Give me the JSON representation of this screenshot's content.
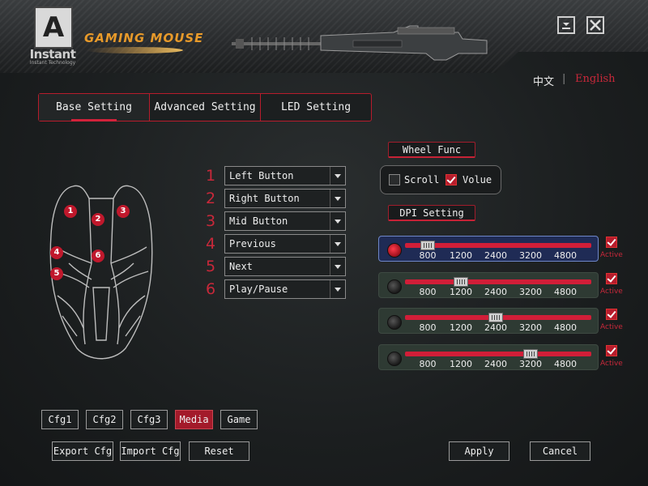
{
  "header": {
    "logo_letter": "A",
    "logo_word": "Instant",
    "logo_subtitle": "Instant Technology",
    "brand_title": "GAMING MOUSE",
    "minimize_icon": "minimize-icon",
    "close_icon": "close-icon"
  },
  "language": {
    "chinese": "中文",
    "separator": "|",
    "english": "English",
    "active_color": "#c8283a"
  },
  "tabs": [
    {
      "label": "Base Setting",
      "active": true
    },
    {
      "label": "Advanced Setting",
      "active": false
    },
    {
      "label": "LED Setting",
      "active": false
    }
  ],
  "buttons_config": [
    {
      "number": "1",
      "value": "Left Button"
    },
    {
      "number": "2",
      "value": "Right Button"
    },
    {
      "number": "3",
      "value": "Mid Button"
    },
    {
      "number": "4",
      "value": "Previous"
    },
    {
      "number": "5",
      "value": "Next"
    },
    {
      "number": "6",
      "value": "Play/Pause"
    }
  ],
  "mouse_badges": [
    "1",
    "2",
    "3",
    "4",
    "5",
    "6"
  ],
  "wheel": {
    "title": "Wheel Func",
    "scroll_label": "Scroll",
    "scroll_checked": false,
    "volume_label": "Volue",
    "volume_checked": true
  },
  "dpi": {
    "title": "DPI Setting",
    "ticks": [
      "800",
      "1200",
      "2400",
      "3200",
      "4800"
    ],
    "rows": [
      {
        "selected": true,
        "value": "800",
        "active": true,
        "active_label": "Active"
      },
      {
        "selected": false,
        "value": "1200",
        "active": true,
        "active_label": "Active"
      },
      {
        "selected": false,
        "value": "2400",
        "active": true,
        "active_label": "Active"
      },
      {
        "selected": false,
        "value": "3200",
        "active": true,
        "active_label": "Active"
      }
    ]
  },
  "configs": [
    {
      "label": "Cfg1",
      "active": false
    },
    {
      "label": "Cfg2",
      "active": false
    },
    {
      "label": "Cfg3",
      "active": false
    },
    {
      "label": "Media",
      "active": true
    },
    {
      "label": "Game",
      "active": false
    }
  ],
  "actions": {
    "export": "Export Cfg",
    "import": "Import Cfg",
    "reset": "Reset",
    "apply": "Apply",
    "cancel": "Cancel"
  },
  "colors": {
    "accent_red": "#c8283a",
    "selected_row": "#1f2b55",
    "row_bg": "#2e3a33",
    "brand_orange": "#e89a2a"
  }
}
